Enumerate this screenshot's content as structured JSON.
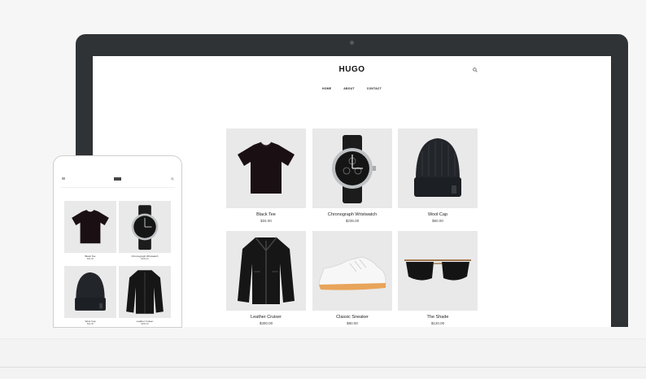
{
  "site": {
    "logo": "HUGO",
    "nav": [
      "HOME",
      "ABOUT",
      "CONTACT"
    ]
  },
  "products": [
    {
      "name": "Black Tee",
      "price": "$34.00",
      "image": "tshirt-icon"
    },
    {
      "name": "Chronograph Wristwatch",
      "price": "$235.00",
      "image": "watch-icon"
    },
    {
      "name": "Wool Cap",
      "price": "$60.00",
      "image": "beanie-icon"
    },
    {
      "name": "Leather Cruiser",
      "price": "$300.00",
      "image": "jacket-icon"
    },
    {
      "name": "Classic Sneaker",
      "price": "$90.00",
      "image": "sneaker-icon"
    },
    {
      "name": "The Shade",
      "price": "$120.00",
      "image": "sunglasses-icon"
    }
  ]
}
